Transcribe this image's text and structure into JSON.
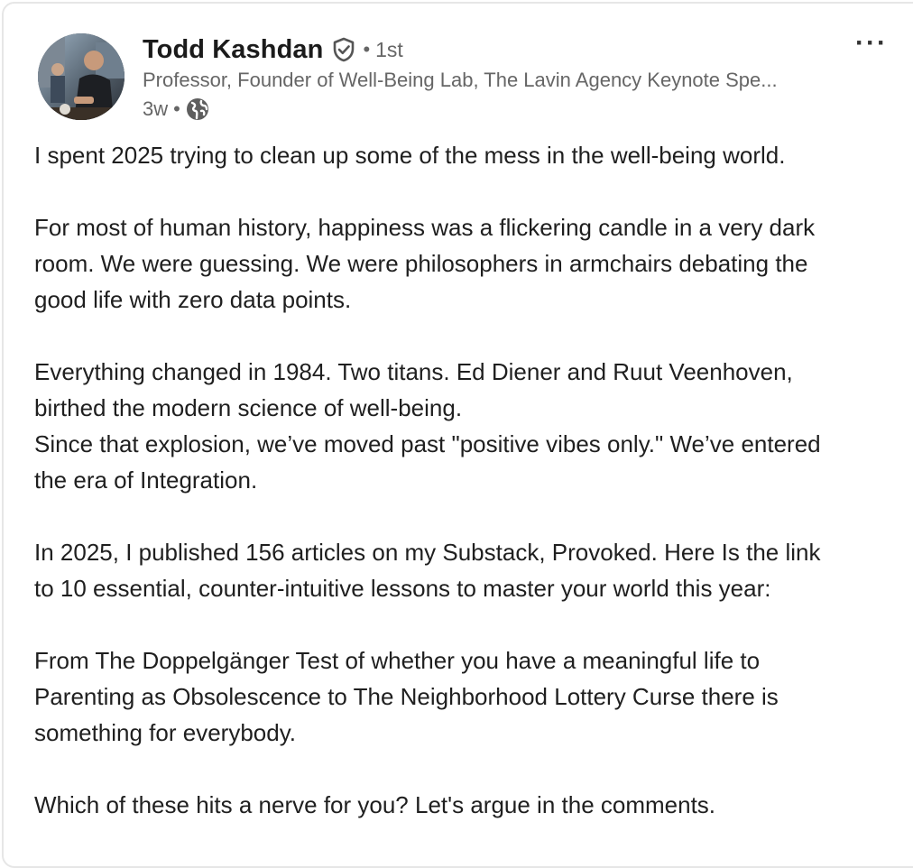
{
  "author": {
    "name": "Todd Kashdan",
    "degree": "1st",
    "headline": "Professor, Founder of Well-Being Lab, The Lavin Agency Keynote Spe...",
    "time": "3w",
    "separator": "•"
  },
  "icons": {
    "verified": "verified-shield-icon",
    "visibility": "globe-icon",
    "more": "more-options-icon",
    "more_glyph": "···"
  },
  "post": {
    "p1": "I spent 2025 trying to clean up some of the mess in the well-being world.",
    "p2_l1": "For most of human history, happiness was a flickering candle in a very dark",
    "p2_l2": "room. We were guessing. We were philosophers in armchairs debating the",
    "p2_l3": "good life with zero data points.",
    "p3_l1": "Everything changed in 1984. Two titans. Ed Diener and Ruut Veenhoven,",
    "p3_l2": "birthed the modern science of well-being.",
    "p4_l1": "Since that explosion, we’ve moved past \"positive vibes only.\" We’ve entered",
    "p4_l2": "the era of Integration.",
    "p5_l1": "In 2025, I published 156 articles on my Substack, Provoked. Here Is the link",
    "p5_l2": "to 10 essential, counter-intuitive lessons to master your world this year:",
    "p6_l1": "From The Doppelgänger Test of whether you have a meaningful life to",
    "p6_l2": "Parenting as Obsolescence to The Neighborhood Lottery Curse there is",
    "p6_l3": "something for everybody.",
    "p7": "Which of these hits a nerve for you? Let's argue in the comments."
  }
}
